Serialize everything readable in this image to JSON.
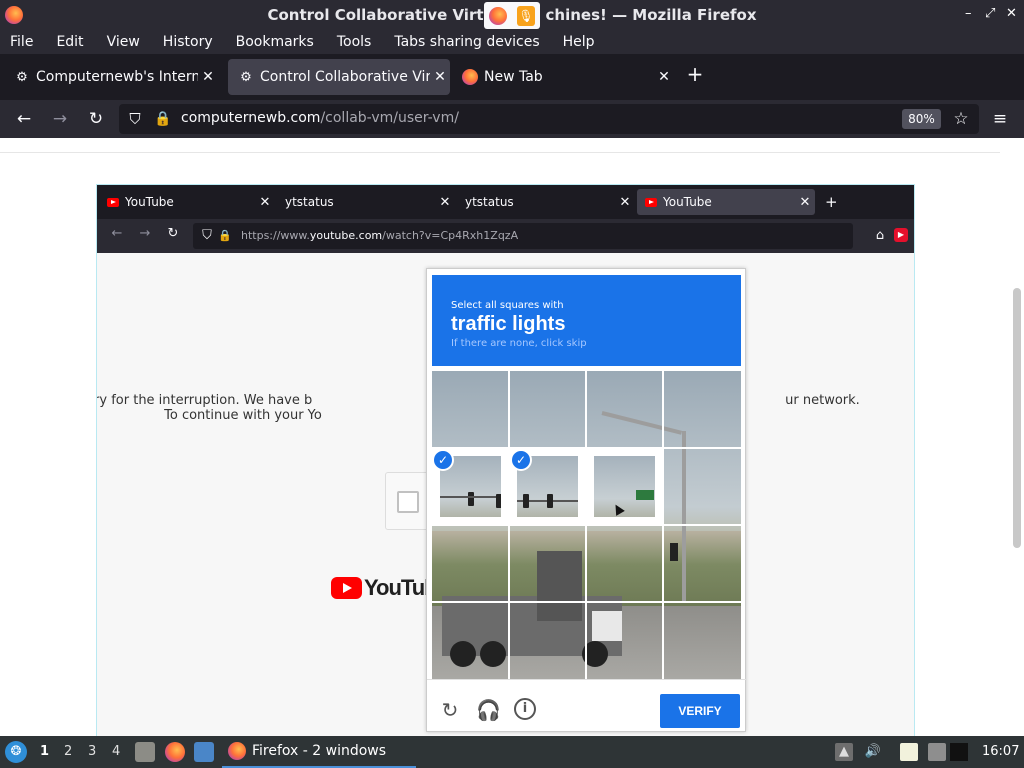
{
  "window": {
    "title": "Control Collaborative Virtual Machines! — Mozilla Firefox",
    "title_left": "Control Collaborative Virt",
    "title_right": "chines! — Mozilla Firefox",
    "controls": [
      "–",
      "⤢",
      "✕"
    ]
  },
  "menubar": [
    "File",
    "Edit",
    "View",
    "History",
    "Bookmarks",
    "Tools",
    "Tabs sharing devices",
    "Help"
  ],
  "tabs": [
    {
      "label": "Computernewb's Internet",
      "active": false,
      "icon": "computernewb-icon"
    },
    {
      "label": "Control Collaborative Virtu",
      "active": true,
      "icon": "computernewb-icon"
    },
    {
      "label": "New Tab",
      "active": false,
      "icon": "firefox-icon"
    }
  ],
  "navbar": {
    "url_host": "computernewb.com",
    "url_path": "/collab-vm/user-vm/",
    "zoom": "80%"
  },
  "vm": {
    "tabs": [
      {
        "label": "YouTube",
        "active": false
      },
      {
        "label": "ytstatus",
        "active": false
      },
      {
        "label": "ytstatus",
        "active": false
      },
      {
        "label": "YouTube",
        "active": true
      }
    ],
    "url_prefix": "https://www.",
    "url_host": "youtube.com",
    "url_path": "/watch?v=Cp4Rxh1ZqzA",
    "sorry_line1_left": "Sorry for the interruption. We have b",
    "sorry_line1_right": "ur network.",
    "sorry_line2": "To continue with your Yo",
    "yt_logo_text": "YouTube"
  },
  "captcha": {
    "instruction_small": "Select all squares with",
    "instruction_big": "traffic lights",
    "instruction_sub": "If there are none, click skip",
    "selected_tiles": [
      4,
      5
    ],
    "verify_label": "VERIFY",
    "footer_icons": [
      "reload-icon",
      "audio-icon",
      "info-icon"
    ]
  },
  "taskbar": {
    "workspaces": [
      "1",
      "2",
      "3",
      "4"
    ],
    "active_workspace": "1",
    "task_label": "Firefox - 2 windows",
    "clock": "16:07"
  },
  "colors": {
    "chrome_dark": "#2b2a33",
    "captcha_blue": "#1a73e8",
    "youtube_red": "#ff0000"
  }
}
